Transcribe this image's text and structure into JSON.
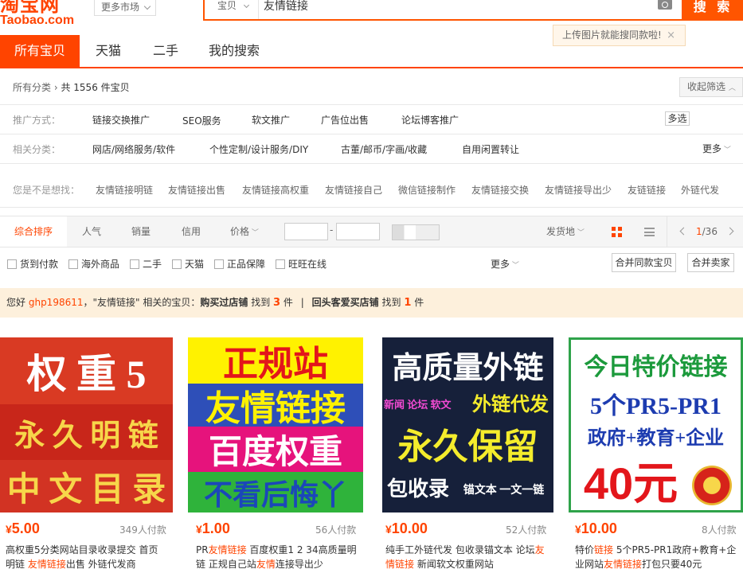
{
  "header": {
    "logo_cn": "淘宝网",
    "logo_en": "Taobao.com",
    "market_label": "更多市场",
    "search_type": "宝贝",
    "search_query": "友情链接",
    "search_button": "搜 索",
    "image_search_tip": "上传图片就能搜同款啦!",
    "tip_close": "×"
  },
  "tabs": [
    "所有宝贝",
    "天猫",
    "二手",
    "我的搜索"
  ],
  "filter": {
    "crumb_all": "所有分类",
    "crumb_count": "共 1556 件宝贝",
    "collapse_label": "收起筛选",
    "promo_label": "推广方式：",
    "promo_options": [
      "链接交换推广",
      "SEO服务",
      "软文推广",
      "广告位出售",
      "论坛博客推广"
    ],
    "multi_label": "多选",
    "related_label": "相关分类：",
    "related_options": [
      "网店/网络服务/软件",
      "个性定制/设计服务/DIY",
      "古董/邮币/字画/收藏",
      "自用闲置转让"
    ],
    "more_label": "更多",
    "guess_label": "您是不是想找：",
    "guess_options": [
      "友情链接明链",
      "友情链接出售",
      "友情链接高权重",
      "友情链接自己",
      "微信链接制作",
      "友情链接交换",
      "友情链接导出少",
      "友链链接",
      "外链代发"
    ]
  },
  "sortbar": {
    "options": [
      "综合排序",
      "人气",
      "销量",
      "信用",
      "价格"
    ],
    "ship_from": "发货地",
    "page_current": "1",
    "page_total": "/36"
  },
  "checks": [
    "货到付款",
    "海外商品",
    "二手",
    "天猫",
    "正品保障",
    "旺旺在线"
  ],
  "checks_more": "更多",
  "merge_same": "合并同款宝贝",
  "merge_seller": "合并卖家",
  "notice": {
    "hello": "您好",
    "user": "ghp198611",
    "part1": "，\"友情链接\" 相关的宝贝：",
    "bought_label": "购买过店铺",
    "found1": "找到",
    "count1": "3",
    "unit1": "件",
    "sep": "|",
    "repeat_label": "回头客爱买店铺",
    "found2": "找到",
    "count2": "1",
    "unit2": "件"
  },
  "products": [
    {
      "price": "5.00",
      "paid": "349人付款",
      "title_line1": "高权重5分类网站目录收录提交 首页",
      "title_line2_a": "明链 ",
      "title_line2_h": "友情链接",
      "title_line2_b": "出售 外链代发商",
      "image_lines": [
        "权 重 5",
        "永 久 明 链",
        "中 文 目 录"
      ]
    },
    {
      "price": "1.00",
      "paid": "56人付款",
      "title_line1_a": "PR",
      "title_line1_h": "友情链接",
      "title_line1_b": " 百度权重1 2 34高质量明",
      "title_line2_a": "链 正规自己站",
      "title_line2_h": "友情",
      "title_line2_b": "连接导出少",
      "image_lines": [
        "正规站",
        "友情链接",
        "百度权重",
        "不看后悔丫"
      ]
    },
    {
      "price": "10.00",
      "paid": "52人付款",
      "title_line1_a": "纯手工外链代发 包收录锚文本 论坛",
      "title_line1_h": "友",
      "title_line2_h": "情链接",
      "title_line2_b": " 新闻软文权重网站",
      "image_lines": [
        "高质量外链",
        "新闻 论坛 软文",
        "外链代发",
        "永久保留",
        "包收录",
        "锚文本 一文一链"
      ]
    },
    {
      "price": "10.00",
      "paid": "8人付款",
      "title_line1_a": "特价",
      "title_line1_h": "链接",
      "title_line1_b": " 5个PR5-PR1政府+教育+企",
      "title_line2_a": "业网站",
      "title_line2_h": "友情链接",
      "title_line2_b": "打包只要40元",
      "image_lines": [
        "今日特价链接",
        "5个PR5-PR1",
        "政府+教育+企业",
        "40元"
      ]
    }
  ],
  "currency": "¥",
  "colors": {
    "accent": "#ff4400",
    "search_orange": "#ff5500",
    "notice_bg": "#fdf0dc"
  }
}
